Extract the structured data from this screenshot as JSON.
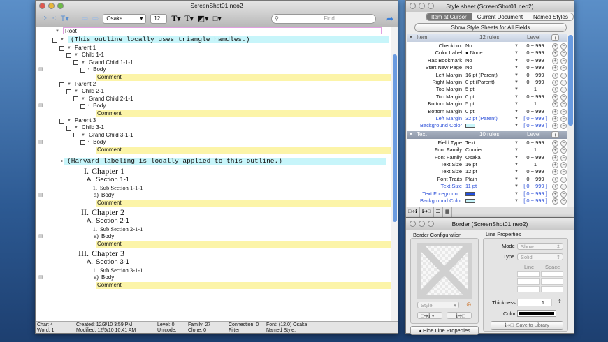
{
  "main": {
    "title": "ScreenShot01.neo2",
    "font": "Osaka",
    "size": "12",
    "find_placeholder": "Find",
    "rows": [
      {
        "type": "root",
        "level": 0,
        "text": "Root"
      },
      {
        "type": "cyan",
        "level": 1,
        "text": "(This outline locally uses triangle handles.)"
      },
      {
        "type": "node",
        "level": 2,
        "text": "Parent 1"
      },
      {
        "type": "node",
        "level": 3,
        "text": "Child 1-1"
      },
      {
        "type": "node",
        "level": 4,
        "text": "Grand Child 1-1-1"
      },
      {
        "type": "body",
        "level": 5,
        "text": "Body",
        "note": true
      },
      {
        "type": "comment",
        "level": 5,
        "text": "Comment"
      },
      {
        "type": "node",
        "level": 2,
        "text": "Parent 2"
      },
      {
        "type": "node",
        "level": 3,
        "text": "Child 2-1"
      },
      {
        "type": "node",
        "level": 4,
        "text": "Grand Child 2-1-1"
      },
      {
        "type": "body",
        "level": 5,
        "text": "Body",
        "note": true
      },
      {
        "type": "comment",
        "level": 5,
        "text": "Comment"
      },
      {
        "type": "node",
        "level": 2,
        "text": "Parent 3"
      },
      {
        "type": "node",
        "level": 3,
        "text": "Child 3-1"
      },
      {
        "type": "node",
        "level": 4,
        "text": "Grand Child 3-1-1"
      },
      {
        "type": "body",
        "level": 5,
        "text": "Body",
        "note": true
      },
      {
        "type": "comment",
        "level": 5,
        "text": "Comment"
      },
      {
        "type": "harvard",
        "level": 1,
        "text": "(Harvard labeling is locally applied to this outline.)"
      },
      {
        "type": "chap",
        "label": "I.",
        "text": "Chapter 1"
      },
      {
        "type": "sect",
        "label": "A.",
        "text": "Section 1-1"
      },
      {
        "type": "sub",
        "label": "1.",
        "text": "Sub Section 1-1-1"
      },
      {
        "type": "hbody",
        "label": "a)",
        "text": "Body",
        "note": true
      },
      {
        "type": "hcomment",
        "text": "Comment"
      },
      {
        "type": "chap",
        "label": "II.",
        "text": "Chapter 2"
      },
      {
        "type": "sect",
        "label": "A.",
        "text": "Section 2-1"
      },
      {
        "type": "sub",
        "label": "1.",
        "text": "Sub Section 2-1-1"
      },
      {
        "type": "hbody",
        "label": "a)",
        "text": "Body",
        "note": true
      },
      {
        "type": "hcomment",
        "text": "Comment"
      },
      {
        "type": "chap",
        "label": "III.",
        "text": "Chapter 3"
      },
      {
        "type": "sect",
        "label": "A.",
        "text": "Section 3-1"
      },
      {
        "type": "sub",
        "label": "1.",
        "text": "Sub Section 3-1-1"
      },
      {
        "type": "hbody",
        "label": "a)",
        "text": "Body",
        "note": true
      },
      {
        "type": "hcomment",
        "text": "Comment"
      }
    ],
    "status": {
      "char": "Char:  4",
      "word": "Word:  1",
      "created": "Created:   12/3/10 3:59 PM",
      "modified": "Modified:  12/5/10 10:41 AM",
      "level": "Level:  0",
      "unicode": "Unicode:",
      "family": "Family:  27",
      "clone": "Clone:  0",
      "connection": "Connection:  0",
      "filter": "Filter:",
      "font": "Font:  (12.0) Osaka",
      "named_style": "Named Style:"
    }
  },
  "stylesheet": {
    "title": "Style sheet (ScreenShot01.neo2)",
    "tabs": [
      "Item at Cursor",
      "Current Document",
      "Named Styles"
    ],
    "show_all": "Show Style Sheets for All Fields",
    "item_header": {
      "name": "Item",
      "rules": "12 rules",
      "level": "Level"
    },
    "item_rows": [
      {
        "label": "Checkbox",
        "value": "No",
        "level": "0 ~ 999"
      },
      {
        "label": "Color Label",
        "value": "● None",
        "level": "0 ~ 999"
      },
      {
        "label": "Has Bookmark",
        "value": "No",
        "level": "0 ~ 999"
      },
      {
        "label": "Start New Page",
        "value": "No",
        "level": "0 ~ 999"
      },
      {
        "label": "Left Margin",
        "value": "16 pt (Parent)",
        "level": "0 ~ 999"
      },
      {
        "label": "Right Margin",
        "value": "0 pt (Parent)",
        "level": "0 ~ 999"
      },
      {
        "label": "Top Margin",
        "value": "5 pt",
        "level": "1"
      },
      {
        "label": "Top Margin",
        "value": "0 pt",
        "level": "0 ~ 999"
      },
      {
        "label": "Bottom Margin",
        "value": "5 pt",
        "level": "1"
      },
      {
        "label": "Bottom Margin",
        "value": "0 pt",
        "level": "0 ~ 999"
      },
      {
        "label": "Left Margin",
        "value": "32 pt (Parent)",
        "level": "[ 0 ~ 999 ]",
        "inherited": true
      },
      {
        "label": "Background Color",
        "value": "",
        "swatch": "#c7f5fa",
        "level": "[ 0 ~ 999 ]",
        "inherited": true
      }
    ],
    "text_header": {
      "name": "Text",
      "rules": "10 rules",
      "level": "Level"
    },
    "text_rows": [
      {
        "label": "Field Type",
        "value": "Text",
        "level": "0 ~ 999"
      },
      {
        "label": "Font Family",
        "value": "Courier",
        "level": "1"
      },
      {
        "label": "Font Family",
        "value": "Osaka",
        "level": "0 ~ 999"
      },
      {
        "label": "Text Size",
        "value": "16 pt",
        "level": "1"
      },
      {
        "label": "Text Size",
        "value": "12 pt",
        "level": "0 ~ 999"
      },
      {
        "label": "Font Traits",
        "value": "Plain",
        "level": "0 ~ 999"
      },
      {
        "label": "Text Size",
        "value": "11 pt",
        "level": "[ 0 ~ 999 ]",
        "inherited": true
      },
      {
        "label": "Text Foregroun...",
        "value": "",
        "swatch": "#2250e0",
        "level": "[ 0 ~ 999 ]",
        "inherited": true
      },
      {
        "label": "Background Color",
        "value": "",
        "swatch": "#c7f5fa",
        "level": "[ 0 ~ 999 ]",
        "inherited": true
      }
    ],
    "footer": [
      "□➔ℹ",
      "ℹ➔□",
      "☰",
      "▦"
    ]
  },
  "border": {
    "title": "Border (ScreenShot01.neo2)",
    "config_label": "Border Configuration",
    "line_props_label": "Line Properties",
    "mode_label": "Mode",
    "mode": "Show",
    "type_label": "Type",
    "type": "Solid",
    "line_col": "Line",
    "space_col": "Space",
    "style": "Style",
    "thickness_label": "Thickness",
    "thickness": "1",
    "color_label": "Color",
    "color": "#000000",
    "copy_btn": "□➔ℹ",
    "paste_btn": "ℹ➔□",
    "save_btn": "Save to Library",
    "save_icon": "ℹ➔□",
    "hide_btn": "Hide Line Properties"
  }
}
